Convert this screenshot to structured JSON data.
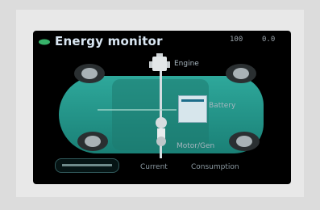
{
  "header": {
    "title": "Energy monitor",
    "leaf_icon": "leaf-icon",
    "status_left": "100",
    "status_right": "0.0"
  },
  "diagram": {
    "labels": {
      "engine": "Engine",
      "battery": "Battery",
      "motor": "Motor/Gen"
    },
    "icons": [
      "engine-icon",
      "battery-icon",
      "motor-icon",
      "wheel-icon"
    ],
    "colors": {
      "body": "#2ea89b",
      "background": "#000000",
      "flow": "#d4dde1"
    }
  },
  "controls": {
    "tab_current": "Current",
    "tab_other": "Consumption"
  }
}
